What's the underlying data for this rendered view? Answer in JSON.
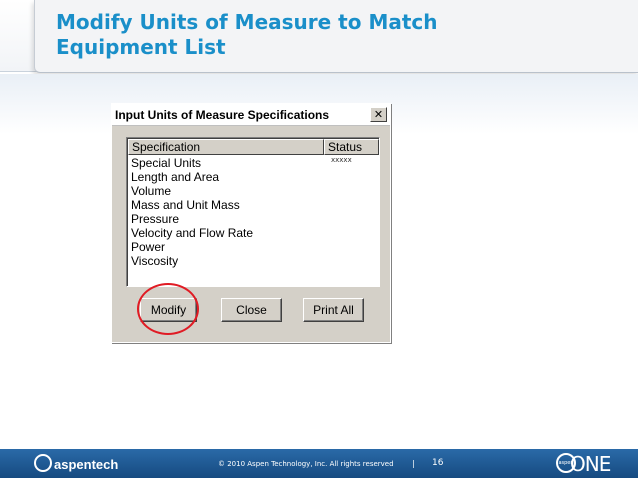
{
  "slide": {
    "title_line1": "Modify Units of Measure to Match",
    "title_line2": "Equipment List"
  },
  "dialog": {
    "title": "Input Units of Measure Specifications",
    "close_glyph": "✕",
    "columns": {
      "specification": "Specification",
      "status": "Status"
    },
    "rows": [
      {
        "specification": "Special Units",
        "status": "xxxxx"
      },
      {
        "specification": "Length and Area",
        "status": ""
      },
      {
        "specification": "Volume",
        "status": ""
      },
      {
        "specification": "Mass and Unit Mass",
        "status": ""
      },
      {
        "specification": "Pressure",
        "status": ""
      },
      {
        "specification": "Velocity and Flow Rate",
        "status": ""
      },
      {
        "specification": "Power",
        "status": ""
      },
      {
        "specification": "Viscosity",
        "status": ""
      }
    ],
    "buttons": {
      "modify": "Modify",
      "close": "Close",
      "print_all": "Print All"
    },
    "highlight_color": "#e01b24"
  },
  "footer": {
    "logo_left_text": "aspentech",
    "copyright": "© 2010 Aspen Technology, Inc. All rights reserved",
    "separator": "|",
    "page_number": "16",
    "logo_right_badge": "aspen",
    "logo_right_text": "ONE"
  }
}
